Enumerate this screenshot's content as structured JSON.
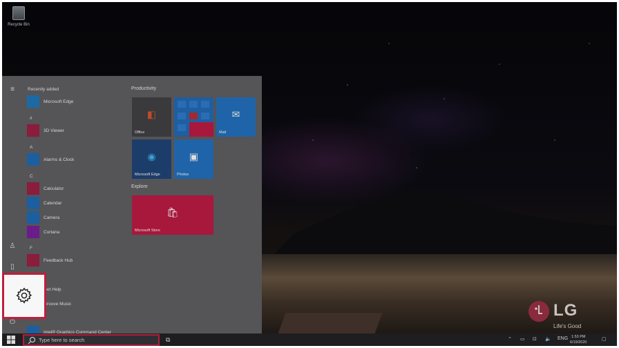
{
  "desktop": {
    "recycle_bin_label": "Recycle Bin",
    "brand": {
      "name": "LG",
      "tagline": "Life's Good"
    }
  },
  "start_menu": {
    "app_list": {
      "recently_added_header": "Recently added",
      "sections": [
        {
          "letter": "",
          "apps": [
            {
              "name": "Microsoft Edge",
              "icon": "edge-icon",
              "color": "#1b6aa5"
            }
          ]
        },
        {
          "letter": "#",
          "apps": [
            {
              "name": "3D Viewer",
              "icon": "3d-viewer-icon",
              "color": "#8a1c3c"
            }
          ]
        },
        {
          "letter": "A",
          "apps": [
            {
              "name": "Alarms & Clock",
              "icon": "alarm-clock-icon",
              "color": "#1b5fa0"
            }
          ]
        },
        {
          "letter": "C",
          "apps": [
            {
              "name": "Calculator",
              "icon": "calculator-icon",
              "color": "#8a1c3c"
            },
            {
              "name": "Calendar",
              "icon": "calendar-icon",
              "color": "#1b5fa0"
            },
            {
              "name": "Camera",
              "icon": "camera-icon",
              "color": "#1b5fa0"
            },
            {
              "name": "Cortana",
              "icon": "cortana-icon",
              "color": "#6a1c8a"
            }
          ]
        },
        {
          "letter": "F",
          "apps": [
            {
              "name": "Feedback Hub",
              "icon": "feedback-hub-icon",
              "color": "#8a1c3c"
            }
          ]
        },
        {
          "letter": "",
          "apps": [
            {
              "name": "Get Help",
              "icon": "get-help-icon",
              "color": "#1b5fa0"
            },
            {
              "name": "Groove Music",
              "icon": "groove-music-icon",
              "color": "#1b5fa0"
            },
            {
              "name": "Intel® Graphics Command Center",
              "icon": "intel-graphics-icon",
              "color": "#1b5fa0"
            }
          ]
        }
      ]
    },
    "groups": [
      {
        "title": "Productivity"
      },
      {
        "title": "Explore"
      }
    ],
    "tiles": {
      "office": "Office",
      "mail": "Mail",
      "edge": "Microsoft Edge",
      "photos": "Photos",
      "store": "Microsoft Store"
    }
  },
  "taskbar": {
    "search_placeholder": "Type here to search",
    "language": "ENG",
    "time": "1:53 PM",
    "date": "6/19/2020"
  },
  "colors": {
    "highlight": "#c01e3c",
    "tile_dark": "#3a3a3c",
    "tile_blue": "#1f64a8",
    "tile_red": "#a8183c"
  }
}
